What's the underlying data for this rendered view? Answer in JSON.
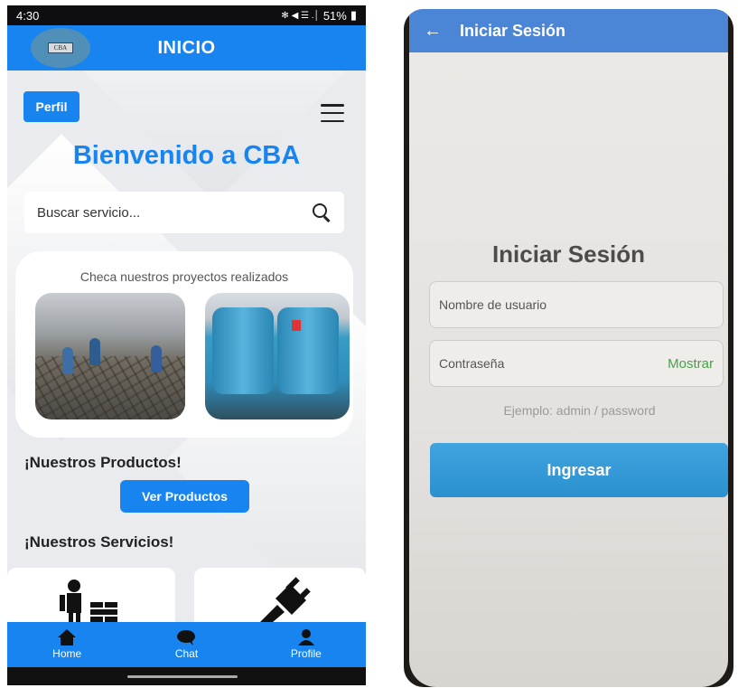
{
  "left_screen": {
    "status_bar": {
      "time": "4:30",
      "notifications": "∞ ∞",
      "signal_icons": "✻ ◀ ☰ .│",
      "battery": "51%"
    },
    "header": {
      "logo_text": "CBA",
      "title": "INICIO"
    },
    "perfil_label": "Perfil",
    "welcome_title": "Bienvenido a CBA",
    "search": {
      "placeholder": "Buscar servicio..."
    },
    "projects": {
      "caption": "Checa nuestros proyectos realizados"
    },
    "products": {
      "title": "¡Nuestros Productos!",
      "button_label": "Ver Productos"
    },
    "services": {
      "title": "¡Nuestros Servicios!"
    },
    "nav": {
      "home": "Home",
      "chat": "Chat",
      "profile": "Profile"
    }
  },
  "right_screen": {
    "header_title": "Iniciar Sesión",
    "title": "Iniciar Sesión",
    "username_placeholder": "Nombre de usuario",
    "password_placeholder": "Contraseña",
    "show_label": "Mostrar",
    "hint": "Ejemplo: admin / password",
    "submit_label": "Ingresar"
  },
  "colors": {
    "primary": "#1784f0",
    "login_header": "#4a85d6",
    "login_button": "#2b90cf",
    "show_link": "#4aa04a"
  }
}
